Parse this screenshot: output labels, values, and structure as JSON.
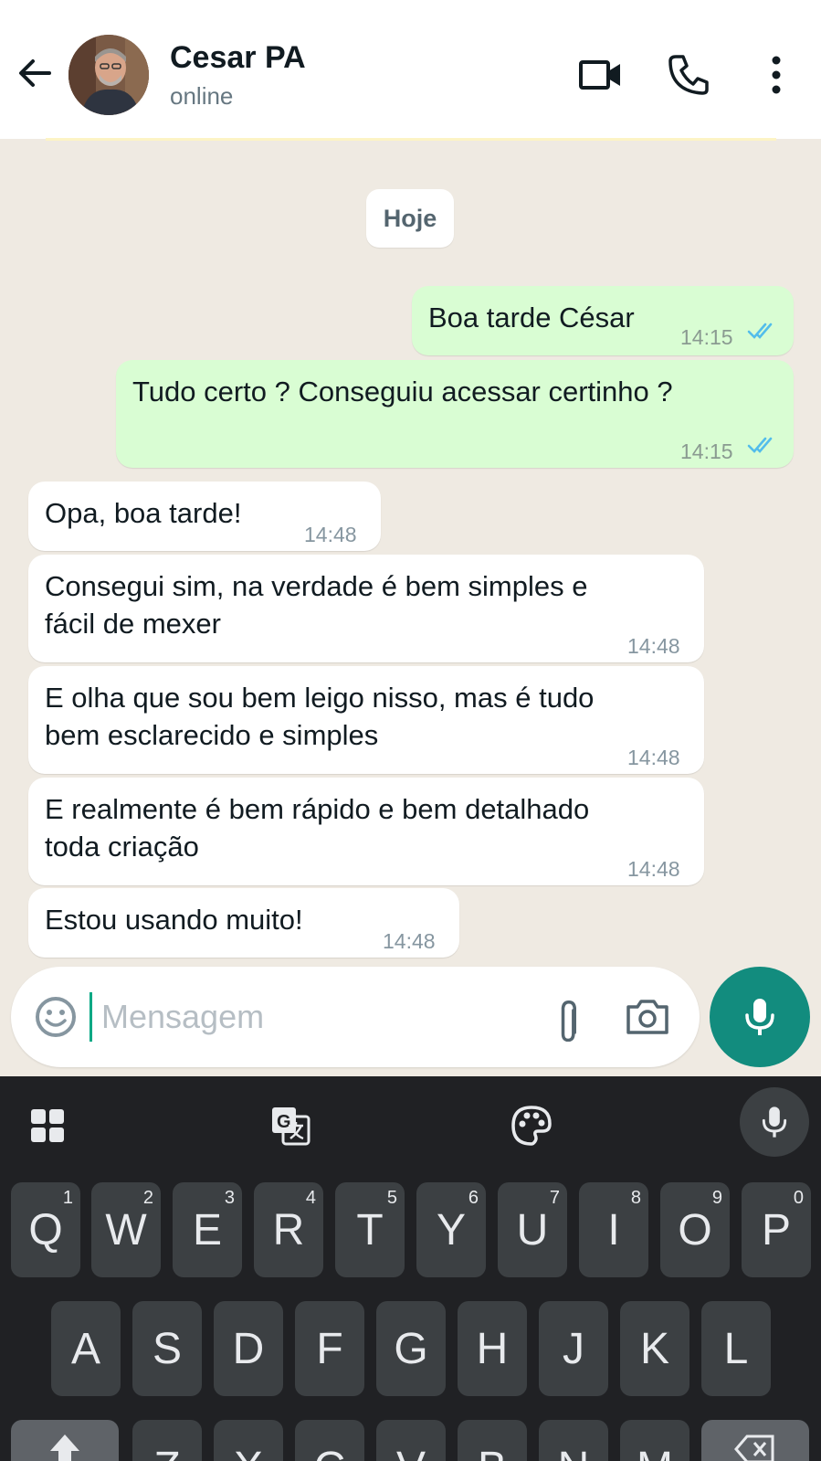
{
  "header": {
    "contact_name": "Cesar PA",
    "status": "online",
    "icons": [
      "arrow-left-icon",
      "video-camera-icon",
      "phone-icon",
      "more-vertical-icon"
    ]
  },
  "chat": {
    "date_chip": "Hoje",
    "messages": [
      {
        "direction": "out",
        "text": "Boa tarde César",
        "time": "14:15",
        "status": "read"
      },
      {
        "direction": "out",
        "text": "Tudo certo ? Conseguiu acessar certinho ?",
        "time": "14:15",
        "status": "read"
      },
      {
        "direction": "in",
        "text": "Opa, boa tarde!",
        "time": "14:48"
      },
      {
        "direction": "in",
        "lines": [
          "Consegui sim, na verdade é bem simples e",
          "fácil de mexer"
        ],
        "time": "14:48"
      },
      {
        "direction": "in",
        "lines": [
          "E olha que sou bem leigo nisso, mas é tudo",
          "bem esclarecido e simples"
        ],
        "time": "14:48"
      },
      {
        "direction": "in",
        "lines": [
          "E realmente é bem rápido e bem detalhado",
          "toda criação"
        ],
        "time": "14:48"
      },
      {
        "direction": "in",
        "text": "Estou usando muito!",
        "time": "14:48"
      }
    ]
  },
  "composer": {
    "placeholder": "Mensagem",
    "value": "",
    "icons": [
      "emoji-icon",
      "attach-icon",
      "camera-icon",
      "microphone-icon"
    ]
  },
  "keyboard": {
    "toolbar_icons": [
      "apps-grid-icon",
      "translate-icon",
      "palette-icon",
      "microphone-icon"
    ],
    "row1": [
      {
        "label": "Q",
        "hint": "1"
      },
      {
        "label": "W",
        "hint": "2"
      },
      {
        "label": "E",
        "hint": "3"
      },
      {
        "label": "R",
        "hint": "4"
      },
      {
        "label": "T",
        "hint": "5"
      },
      {
        "label": "Y",
        "hint": "6"
      },
      {
        "label": "U",
        "hint": "7"
      },
      {
        "label": "I",
        "hint": "8"
      },
      {
        "label": "O",
        "hint": "9"
      },
      {
        "label": "P",
        "hint": "0"
      }
    ],
    "row2": [
      "A",
      "S",
      "D",
      "F",
      "G",
      "H",
      "J",
      "K",
      "L"
    ],
    "row3": [
      "Z",
      "X",
      "C",
      "V",
      "B",
      "N",
      "M"
    ]
  },
  "colors": {
    "outgoing_bubble": "#d9fdd3",
    "incoming_bubble": "#ffffff",
    "chat_background": "#efeae2",
    "accent": "#128c7e",
    "read_ticks": "#53bdeb",
    "keyboard_background": "#202124",
    "key": "#3c4043"
  }
}
